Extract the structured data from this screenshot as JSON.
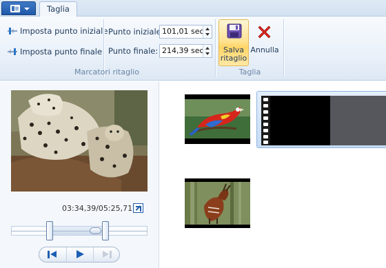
{
  "tabs": {
    "active_label": "Taglia"
  },
  "ribbon": {
    "markers_group": {
      "label": "Marcatori ritaglio",
      "set_start_label": "Imposta punto iniziale",
      "set_end_label": "Imposta punto finale",
      "start_field_label": "Punto iniziale:",
      "start_value": "101,01 sec",
      "end_field_label": "Punto finale:",
      "end_value": "214,39 sec"
    },
    "trim_group": {
      "label": "Taglia",
      "save_label_line1": "Salva",
      "save_label_line2": "ritaglio",
      "cancel_label": "Annulla"
    }
  },
  "preview": {
    "time_readout": "03:34,39/05:25,71"
  },
  "trim_slider": {
    "start_fraction": 0.31,
    "end_fraction": 0.66,
    "position_fraction": 0.62
  },
  "colors": {
    "accent": "#1b5fb4",
    "ribbon_bg": "#eaf1f9",
    "save_highlight": "#ffd566",
    "cancel_red": "#d9251d"
  },
  "icons": {
    "app_menu": "menu-icon",
    "save": "floppy-disk-icon",
    "cancel": "red-x-icon",
    "fullscreen": "expand-icon",
    "prev": "previous-frame-icon",
    "play": "play-icon",
    "next": "next-frame-icon"
  }
}
